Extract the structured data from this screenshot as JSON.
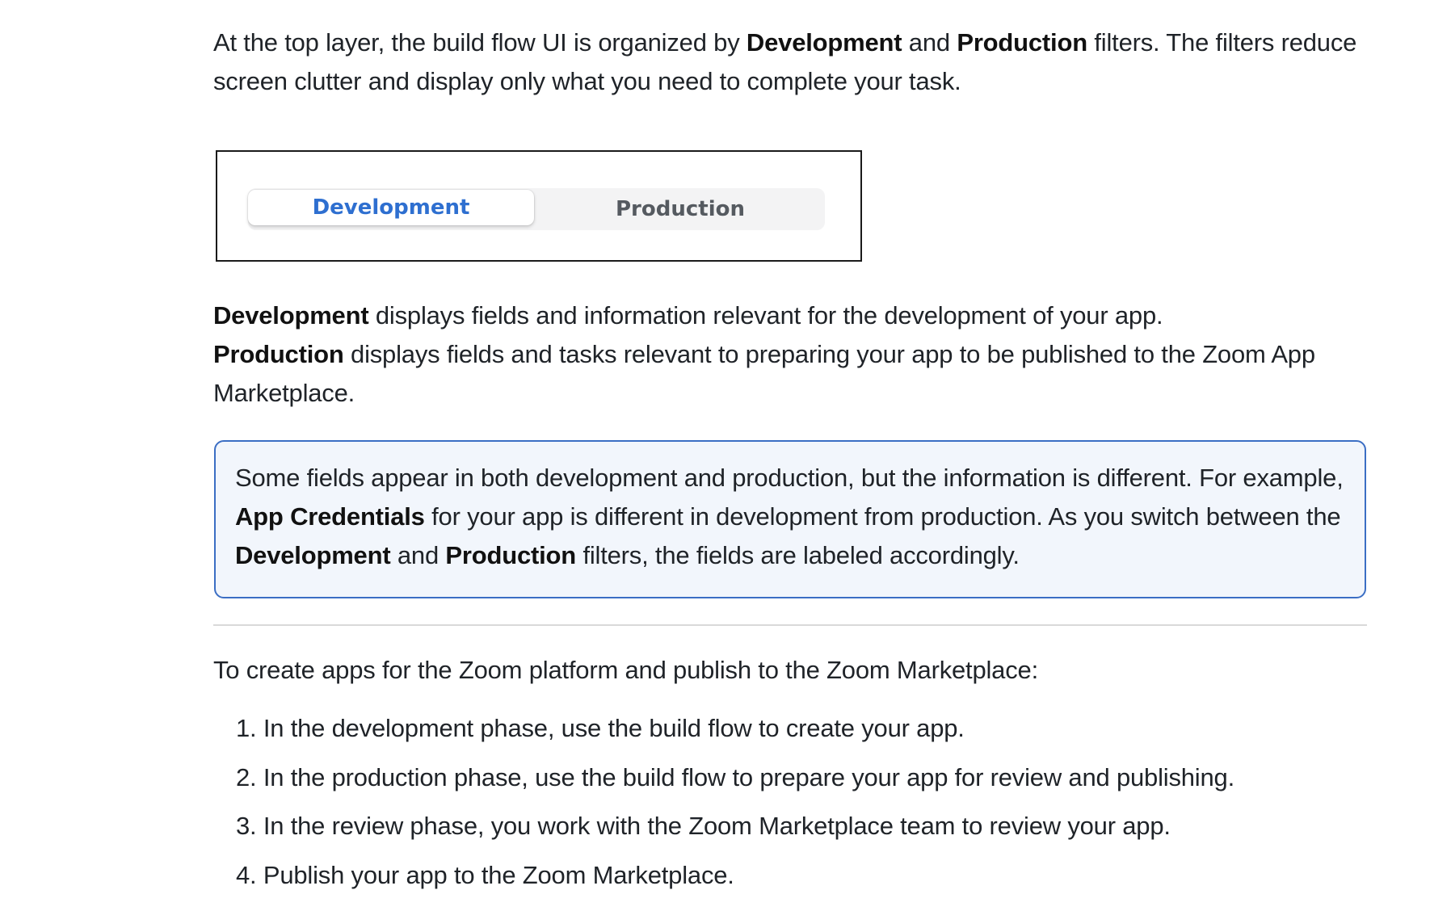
{
  "intro": {
    "t1": "At the top layer, the build flow UI is organized by ",
    "b1": "Development",
    "t2": " and ",
    "b2": "Production",
    "t3": " filters. The filters reduce screen clutter and display only what you need to complete your task."
  },
  "filter_toggle": {
    "development_label": "Development",
    "production_label": "Production",
    "active": "Development",
    "accent_color": "#2e6fd0"
  },
  "description": {
    "dev_bold": "Development",
    "dev_text": " displays fields and information relevant for the development of your app.",
    "prod_bold": "Production",
    "prod_text": " displays fields and tasks relevant to preparing your app to be published to the Zoom App Marketplace."
  },
  "note": {
    "t1": "Some fields appear in both development and production, but the information is different. For example, ",
    "b1": "App Credentials",
    "t2": " for your app is different in development from production. As you switch between the ",
    "b2": "Development",
    "t3": " and ",
    "b3": "Production",
    "t4": " filters, the fields are labeled accordingly.",
    "border_color": "#3b6ec4"
  },
  "lead": "To create apps for the Zoom platform and publish to the Zoom Marketplace:",
  "steps": [
    "1. In the development phase, use the build flow to create your app.",
    "2. In the production phase, use the build flow to prepare your app for review and publishing.",
    "3. In the review phase, you work with the Zoom Marketplace team to review your app.",
    "4. Publish your app to the Zoom Marketplace."
  ]
}
